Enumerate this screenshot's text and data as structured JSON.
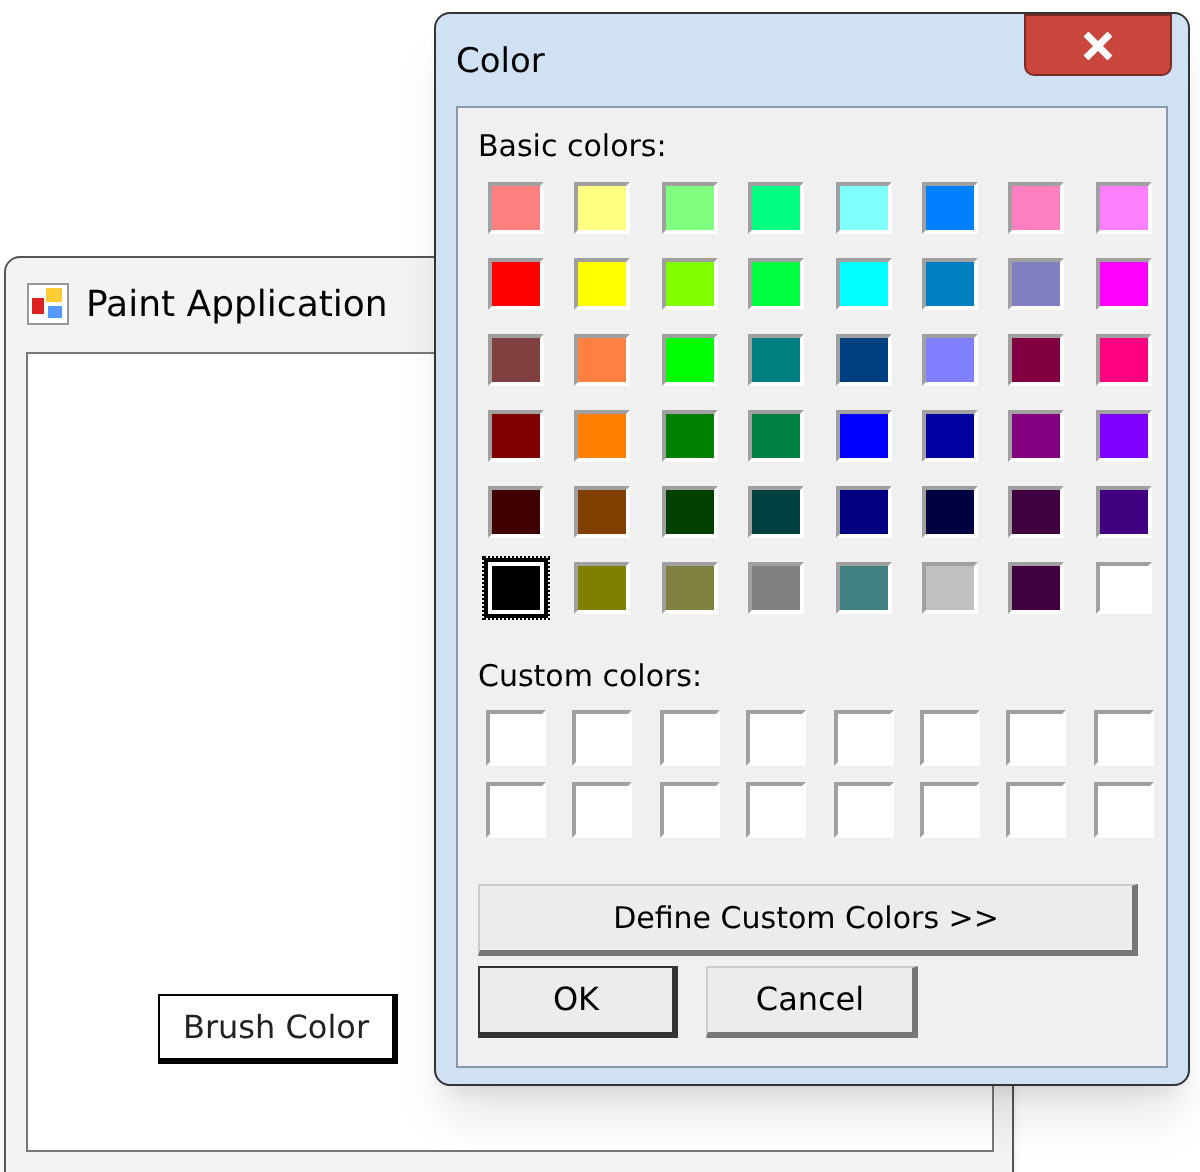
{
  "main_window": {
    "title": "Paint Application",
    "button": "Brush Color"
  },
  "color_dialog": {
    "title": "Color",
    "basic_label": "Basic colors:",
    "basic_colors": [
      {
        "color": "#ff8080",
        "selected": false
      },
      {
        "color": "#ffff80",
        "selected": false
      },
      {
        "color": "#80ff80",
        "selected": false
      },
      {
        "color": "#00ff80",
        "selected": false
      },
      {
        "color": "#80ffff",
        "selected": false
      },
      {
        "color": "#0080ff",
        "selected": false
      },
      {
        "color": "#ff80c0",
        "selected": false
      },
      {
        "color": "#ff80ff",
        "selected": false
      },
      {
        "color": "#ff0000",
        "selected": false
      },
      {
        "color": "#ffff00",
        "selected": false
      },
      {
        "color": "#80ff00",
        "selected": false
      },
      {
        "color": "#00ff40",
        "selected": false
      },
      {
        "color": "#00ffff",
        "selected": false
      },
      {
        "color": "#0080c0",
        "selected": false
      },
      {
        "color": "#8080c0",
        "selected": false
      },
      {
        "color": "#ff00ff",
        "selected": false
      },
      {
        "color": "#804040",
        "selected": false
      },
      {
        "color": "#ff8040",
        "selected": false
      },
      {
        "color": "#00ff00",
        "selected": false
      },
      {
        "color": "#008080",
        "selected": false
      },
      {
        "color": "#004080",
        "selected": false
      },
      {
        "color": "#8080ff",
        "selected": false
      },
      {
        "color": "#800040",
        "selected": false
      },
      {
        "color": "#ff0080",
        "selected": false
      },
      {
        "color": "#800000",
        "selected": false
      },
      {
        "color": "#ff8000",
        "selected": false
      },
      {
        "color": "#008000",
        "selected": false
      },
      {
        "color": "#008040",
        "selected": false
      },
      {
        "color": "#0000ff",
        "selected": false
      },
      {
        "color": "#0000a0",
        "selected": false
      },
      {
        "color": "#800080",
        "selected": false
      },
      {
        "color": "#8000ff",
        "selected": false
      },
      {
        "color": "#400000",
        "selected": false
      },
      {
        "color": "#804000",
        "selected": false
      },
      {
        "color": "#004000",
        "selected": false
      },
      {
        "color": "#004040",
        "selected": false
      },
      {
        "color": "#000080",
        "selected": false
      },
      {
        "color": "#000040",
        "selected": false
      },
      {
        "color": "#400040",
        "selected": false
      },
      {
        "color": "#400080",
        "selected": false
      },
      {
        "color": "#000000",
        "selected": true
      },
      {
        "color": "#808000",
        "selected": false
      },
      {
        "color": "#808040",
        "selected": false
      },
      {
        "color": "#808080",
        "selected": false
      },
      {
        "color": "#408080",
        "selected": false
      },
      {
        "color": "#c0c0c0",
        "selected": false
      },
      {
        "color": "#400040",
        "selected": false
      },
      {
        "color": "#ffffff",
        "selected": false
      }
    ],
    "custom_label": "Custom colors:",
    "custom_colors": [
      {
        "color": "#ffffff"
      },
      {
        "color": "#ffffff"
      },
      {
        "color": "#ffffff"
      },
      {
        "color": "#ffffff"
      },
      {
        "color": "#ffffff"
      },
      {
        "color": "#ffffff"
      },
      {
        "color": "#ffffff"
      },
      {
        "color": "#ffffff"
      },
      {
        "color": "#ffffff"
      },
      {
        "color": "#ffffff"
      },
      {
        "color": "#ffffff"
      },
      {
        "color": "#ffffff"
      },
      {
        "color": "#ffffff"
      },
      {
        "color": "#ffffff"
      },
      {
        "color": "#ffffff"
      },
      {
        "color": "#ffffff"
      }
    ],
    "define_button": "Define Custom Colors >>",
    "ok_button": "OK",
    "cancel_button": "Cancel"
  }
}
